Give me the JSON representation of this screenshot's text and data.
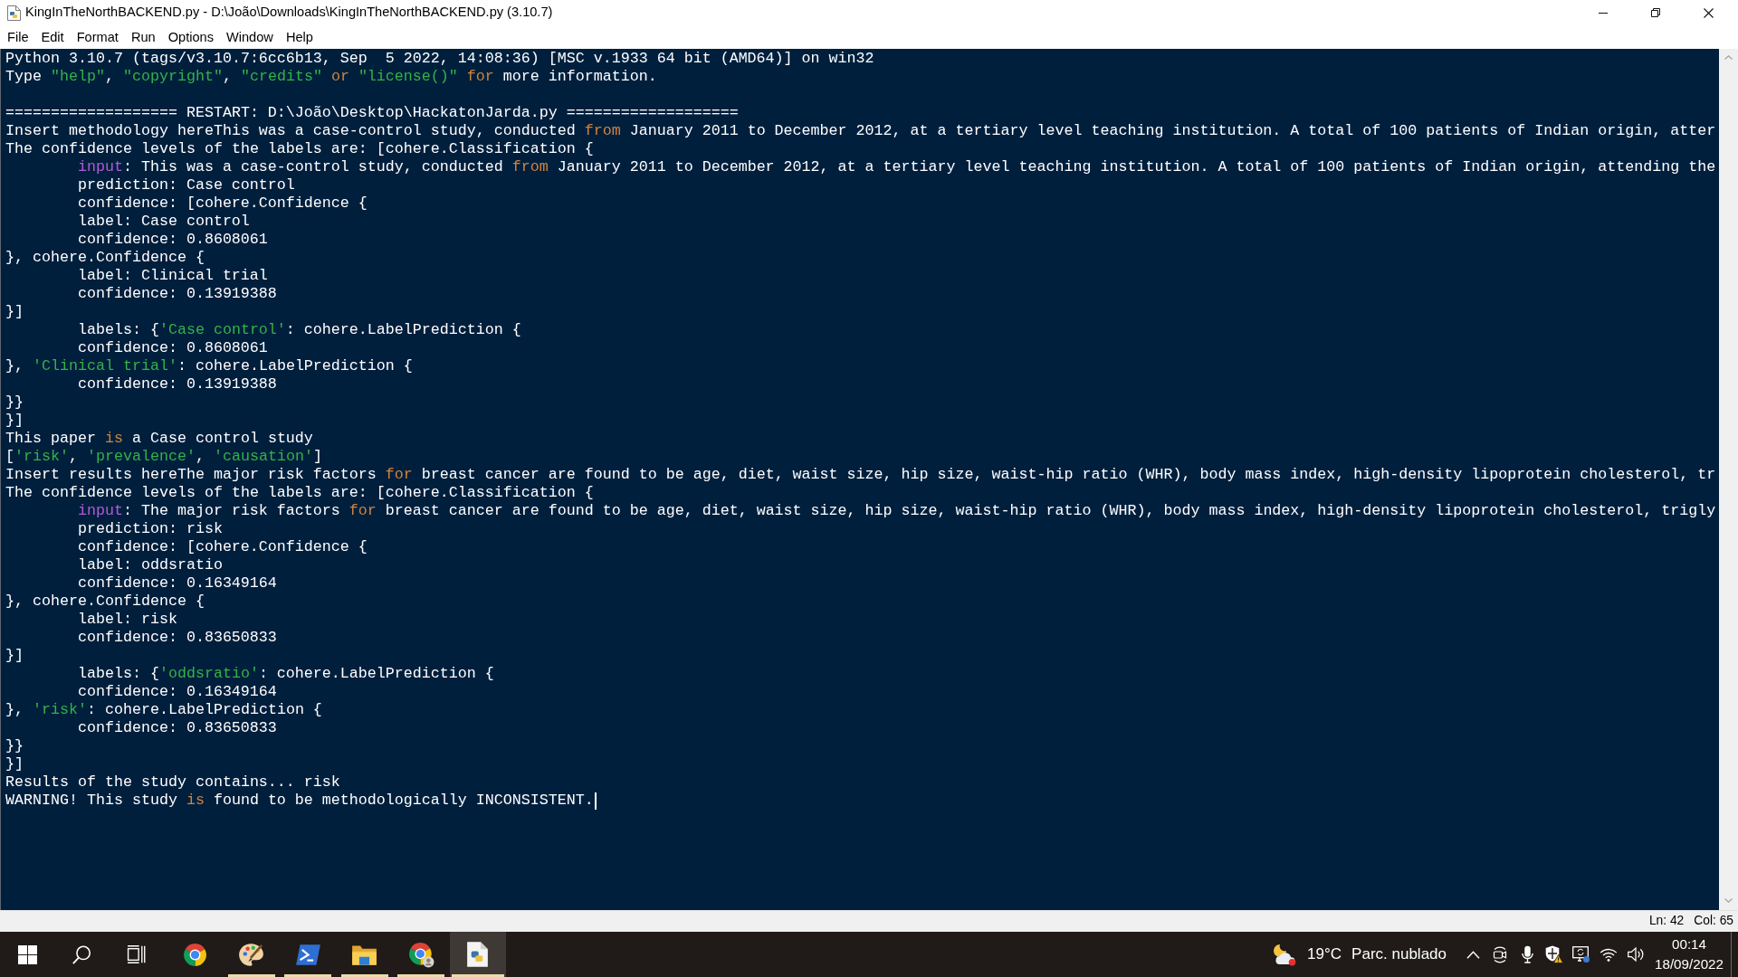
{
  "window": {
    "title": "KingInTheNorthBACKEND.py - D:\\João\\Downloads\\KingInTheNorthBACKEND.py (3.10.7)"
  },
  "menu_bar": [
    "File",
    "Edit",
    "Format",
    "Run",
    "Options",
    "Window",
    "Help"
  ],
  "shell": {
    "cursor_at_end": true,
    "lines": [
      {
        "kind": "text",
        "indented": false,
        "segments": [
          {
            "kind": "plain",
            "text": "Python 3.10.7 (tags/v3.10.7:6cc6b13, Sep  5 2022, 14:08:36) [MSC v.1933 64 bit (AMD64)] on win32"
          }
        ]
      },
      {
        "kind": "text",
        "indented": false,
        "segments": [
          {
            "kind": "plain",
            "text": "Type "
          },
          {
            "kind": "string",
            "text": "\"help\""
          },
          {
            "kind": "plain",
            "text": ", "
          },
          {
            "kind": "string",
            "text": "\"copyright\""
          },
          {
            "kind": "plain",
            "text": ", "
          },
          {
            "kind": "string",
            "text": "\"credits\""
          },
          {
            "kind": "keyword",
            "text": " or "
          },
          {
            "kind": "string",
            "text": "\"license()\""
          },
          {
            "kind": "keyword",
            "text": " for"
          },
          {
            "kind": "plain",
            "text": " more information."
          }
        ]
      },
      {
        "kind": "blank"
      },
      {
        "kind": "text",
        "indented": false,
        "segments": [
          {
            "kind": "plain",
            "text": "=================== RESTART: D:\\João\\Desktop\\HackatonJarda.py ==================="
          }
        ]
      },
      {
        "kind": "text",
        "indented": false,
        "segments": [
          {
            "kind": "plain",
            "text": "Insert methodology hereThis was a case-control study, conducted "
          },
          {
            "kind": "keyword",
            "text": "from"
          },
          {
            "kind": "plain",
            "text": " January 2011 to December 2012, at a tertiary level teaching institution. A total of 100 patients of Indian origin, atter"
          }
        ]
      },
      {
        "kind": "text",
        "indented": false,
        "segments": [
          {
            "kind": "plain",
            "text": "The confidence levels of the labels are: [cohere.Classification {"
          }
        ]
      },
      {
        "kind": "text",
        "indented": true,
        "segments": [
          {
            "kind": "builtin",
            "text": "input"
          },
          {
            "kind": "plain",
            "text": ": This was a case-control study, conducted "
          },
          {
            "kind": "keyword",
            "text": "from"
          },
          {
            "kind": "plain",
            "text": " January 2011 to December 2012, at a tertiary level teaching institution. A total of 100 patients of Indian origin, attending the"
          }
        ]
      },
      {
        "kind": "text",
        "indented": true,
        "segments": [
          {
            "kind": "plain",
            "text": "prediction: Case control"
          }
        ]
      },
      {
        "kind": "text",
        "indented": true,
        "segments": [
          {
            "kind": "plain",
            "text": "confidence: [cohere.Confidence {"
          }
        ]
      },
      {
        "kind": "text",
        "indented": true,
        "segments": [
          {
            "kind": "plain",
            "text": "label: Case control"
          }
        ]
      },
      {
        "kind": "text",
        "indented": true,
        "segments": [
          {
            "kind": "plain",
            "text": "confidence: 0.8608061"
          }
        ]
      },
      {
        "kind": "text",
        "indented": false,
        "segments": [
          {
            "kind": "plain",
            "text": "}, cohere.Confidence {"
          }
        ]
      },
      {
        "kind": "text",
        "indented": true,
        "segments": [
          {
            "kind": "plain",
            "text": "label: Clinical trial"
          }
        ]
      },
      {
        "kind": "text",
        "indented": true,
        "segments": [
          {
            "kind": "plain",
            "text": "confidence: 0.13919388"
          }
        ]
      },
      {
        "kind": "text",
        "indented": false,
        "segments": [
          {
            "kind": "plain",
            "text": "}]"
          }
        ]
      },
      {
        "kind": "text",
        "indented": true,
        "segments": [
          {
            "kind": "plain",
            "text": "labels: {"
          },
          {
            "kind": "string",
            "text": "'Case control'"
          },
          {
            "kind": "plain",
            "text": ": cohere.LabelPrediction {"
          }
        ]
      },
      {
        "kind": "text",
        "indented": true,
        "segments": [
          {
            "kind": "plain",
            "text": "confidence: 0.8608061"
          }
        ]
      },
      {
        "kind": "text",
        "indented": false,
        "segments": [
          {
            "kind": "plain",
            "text": "}, "
          },
          {
            "kind": "string",
            "text": "'Clinical trial'"
          },
          {
            "kind": "plain",
            "text": ": cohere.LabelPrediction {"
          }
        ]
      },
      {
        "kind": "text",
        "indented": true,
        "segments": [
          {
            "kind": "plain",
            "text": "confidence: 0.13919388"
          }
        ]
      },
      {
        "kind": "text",
        "indented": false,
        "segments": [
          {
            "kind": "plain",
            "text": "}}"
          }
        ]
      },
      {
        "kind": "text",
        "indented": false,
        "segments": [
          {
            "kind": "plain",
            "text": "}]"
          }
        ]
      },
      {
        "kind": "text",
        "indented": false,
        "segments": [
          {
            "kind": "plain",
            "text": "This paper"
          },
          {
            "kind": "keyword",
            "text": " is "
          },
          {
            "kind": "plain",
            "text": "a Case control study"
          }
        ]
      },
      {
        "kind": "text",
        "indented": false,
        "segments": [
          {
            "kind": "plain",
            "text": "["
          },
          {
            "kind": "string",
            "text": "'risk'"
          },
          {
            "kind": "plain",
            "text": ", "
          },
          {
            "kind": "string",
            "text": "'prevalence'"
          },
          {
            "kind": "plain",
            "text": ", "
          },
          {
            "kind": "string",
            "text": "'causation'"
          },
          {
            "kind": "plain",
            "text": "]"
          }
        ]
      },
      {
        "kind": "text",
        "indented": false,
        "segments": [
          {
            "kind": "plain",
            "text": "Insert results hereThe major risk factors "
          },
          {
            "kind": "keyword",
            "text": "for"
          },
          {
            "kind": "plain",
            "text": " breast cancer are found to be age, diet, waist size, hip size, waist-hip ratio (WHR), body mass index, high-density lipoprotein cholesterol, tr"
          }
        ]
      },
      {
        "kind": "text",
        "indented": false,
        "segments": [
          {
            "kind": "plain",
            "text": "The confidence levels of the labels are: [cohere.Classification {"
          }
        ]
      },
      {
        "kind": "text",
        "indented": true,
        "segments": [
          {
            "kind": "builtin",
            "text": "input"
          },
          {
            "kind": "plain",
            "text": ": The major risk factors "
          },
          {
            "kind": "keyword",
            "text": "for"
          },
          {
            "kind": "plain",
            "text": " breast cancer are found to be age, diet, waist size, hip size, waist-hip ratio (WHR), body mass index, high-density lipoprotein cholesterol, trigly"
          }
        ]
      },
      {
        "kind": "text",
        "indented": true,
        "segments": [
          {
            "kind": "plain",
            "text": "prediction: risk"
          }
        ]
      },
      {
        "kind": "text",
        "indented": true,
        "segments": [
          {
            "kind": "plain",
            "text": "confidence: [cohere.Confidence {"
          }
        ]
      },
      {
        "kind": "text",
        "indented": true,
        "segments": [
          {
            "kind": "plain",
            "text": "label: oddsratio"
          }
        ]
      },
      {
        "kind": "text",
        "indented": true,
        "segments": [
          {
            "kind": "plain",
            "text": "confidence: 0.16349164"
          }
        ]
      },
      {
        "kind": "text",
        "indented": false,
        "segments": [
          {
            "kind": "plain",
            "text": "}, cohere.Confidence {"
          }
        ]
      },
      {
        "kind": "text",
        "indented": true,
        "segments": [
          {
            "kind": "plain",
            "text": "label: risk"
          }
        ]
      },
      {
        "kind": "text",
        "indented": true,
        "segments": [
          {
            "kind": "plain",
            "text": "confidence: 0.83650833"
          }
        ]
      },
      {
        "kind": "text",
        "indented": false,
        "segments": [
          {
            "kind": "plain",
            "text": "}]"
          }
        ]
      },
      {
        "kind": "text",
        "indented": true,
        "segments": [
          {
            "kind": "plain",
            "text": "labels: {"
          },
          {
            "kind": "string",
            "text": "'oddsratio'"
          },
          {
            "kind": "plain",
            "text": ": cohere.LabelPrediction {"
          }
        ]
      },
      {
        "kind": "text",
        "indented": true,
        "segments": [
          {
            "kind": "plain",
            "text": "confidence: 0.16349164"
          }
        ]
      },
      {
        "kind": "text",
        "indented": false,
        "segments": [
          {
            "kind": "plain",
            "text": "}, "
          },
          {
            "kind": "string",
            "text": "'risk'"
          },
          {
            "kind": "plain",
            "text": ": cohere.LabelPrediction {"
          }
        ]
      },
      {
        "kind": "text",
        "indented": true,
        "segments": [
          {
            "kind": "plain",
            "text": "confidence: 0.83650833"
          }
        ]
      },
      {
        "kind": "text",
        "indented": false,
        "segments": [
          {
            "kind": "plain",
            "text": "}}"
          }
        ]
      },
      {
        "kind": "text",
        "indented": false,
        "segments": [
          {
            "kind": "plain",
            "text": "}]"
          }
        ]
      },
      {
        "kind": "text",
        "indented": false,
        "segments": [
          {
            "kind": "plain",
            "text": "Results of the study contains... risk"
          }
        ]
      },
      {
        "kind": "text",
        "indented": false,
        "segments": [
          {
            "kind": "plain",
            "text": "WARNING! This study"
          },
          {
            "kind": "keyword",
            "text": " is "
          },
          {
            "kind": "plain",
            "text": "found to be methodologically INCONSISTENT."
          }
        ]
      }
    ]
  },
  "status_bar": {
    "line": "Ln: 42",
    "column": "Col: 65"
  },
  "taskbar": {
    "apps": [
      {
        "kind": "chrome",
        "running": false,
        "selected": false
      },
      {
        "kind": "paint",
        "running": true,
        "selected": false
      },
      {
        "kind": "terminal",
        "running": true,
        "selected": false
      },
      {
        "kind": "folder",
        "running": true,
        "selected": false
      },
      {
        "kind": "chrome_profile",
        "running": true,
        "selected": false
      },
      {
        "kind": "idle",
        "running": true,
        "selected": true
      }
    ],
    "weather": {
      "temperature": "19°C",
      "condition": "Parc. nublado"
    },
    "clock": {
      "time": "00:14",
      "date": "18/09/2022"
    }
  }
}
